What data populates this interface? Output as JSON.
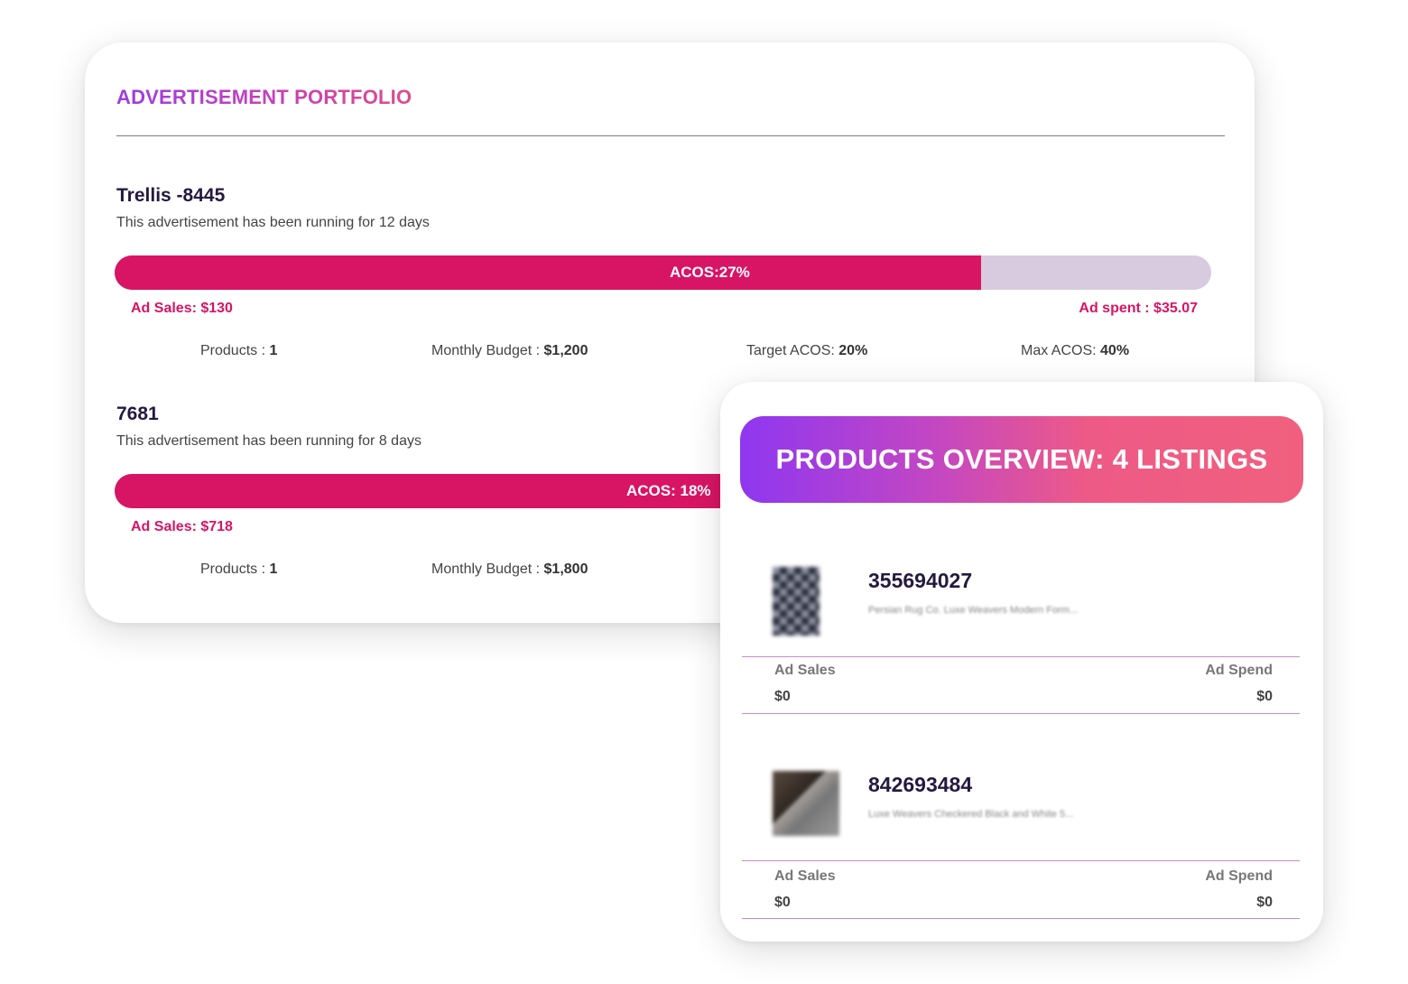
{
  "portfolio": {
    "title": "ADVERTISEMENT PORTFOLIO",
    "ads": [
      {
        "name": "Trellis -8445",
        "running": "This advertisement has been running for 12 days",
        "acos_label": "ACOS:27%",
        "acos_fill_fraction": 0.79,
        "ad_sales": "Ad Sales: $130",
        "ad_spent": "Ad spent : $35.07",
        "products_label": "Products :",
        "products_value": "1",
        "budget_label": "Monthly Budget :",
        "budget_value": "$1,200",
        "target_label": "Target ACOS:",
        "target_value": "20%",
        "max_label": "Max ACOS:",
        "max_value": "40%"
      },
      {
        "name": "7681",
        "running": "This advertisement has been running for 8 days",
        "acos_label": "ACOS: 18%",
        "acos_fill_fraction": 1.0,
        "ad_sales": "Ad Sales: $718",
        "products_label": "Products :",
        "products_value": "1",
        "budget_label": "Monthly Budget :",
        "budget_value": "$1,800"
      }
    ]
  },
  "overview": {
    "title": "PRODUCTS OVERVIEW: 4 LISTINGS",
    "products": [
      {
        "id": "355694027",
        "desc": "Persian Rug Co. Luxe Weavers Modern Form...",
        "ad_sales_label": "Ad Sales",
        "ad_sales_value": "$0",
        "ad_spend_label": "Ad Spend",
        "ad_spend_value": "$0"
      },
      {
        "id": "842693484",
        "desc": "Luxe Weavers Checkered Black and White 5...",
        "ad_sales_label": "Ad Sales",
        "ad_sales_value": "$0",
        "ad_spend_label": "Ad Spend",
        "ad_spend_value": "$0"
      }
    ]
  },
  "colors": {
    "accent": "#d81465",
    "track": "#d8cadf",
    "heading": "#24193f"
  }
}
